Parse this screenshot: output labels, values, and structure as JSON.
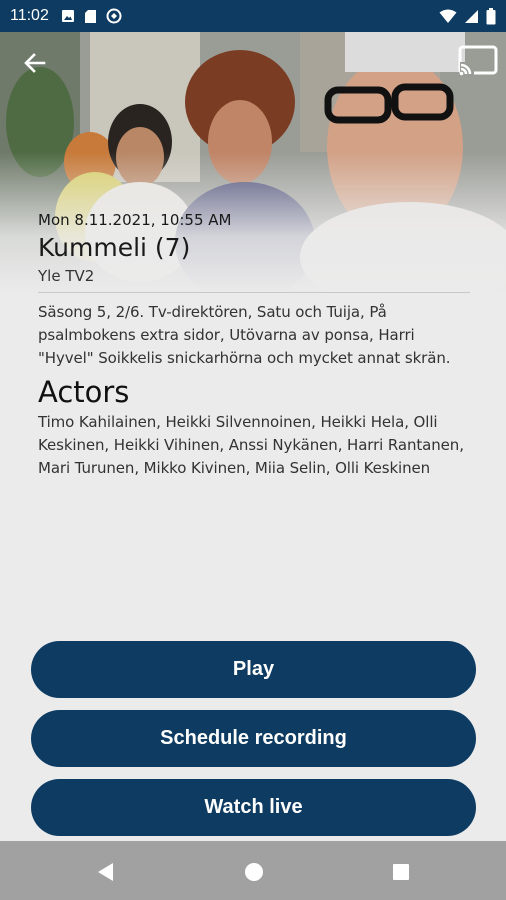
{
  "status_bar": {
    "time": "11:02",
    "left_icons": [
      "image-icon",
      "sd-card-icon",
      "sync-icon"
    ],
    "right_icons": [
      "wifi-icon",
      "signal-icon",
      "battery-icon"
    ]
  },
  "header": {
    "back_icon": "arrow-back-icon",
    "cast_icon": "cast-icon"
  },
  "program": {
    "air_time": "Mon 8.11.2021, 10:55 AM",
    "title": "Kummeli (7)",
    "channel": "Yle TV2",
    "description": "Säsong 5, 2/6. Tv-direktören, Satu och Tuija, På psalmbokens extra sidor, Utövarna av ponsa, Harri \"Hyvel\" Soikkelis snickarhörna och mycket annat skrän.",
    "actors_heading": "Actors",
    "actors": "Timo Kahilainen, Heikki Silvennoinen, Heikki Hela, Olli Keskinen, Heikki Vihinen, Anssi Nykänen, Harri Rantanen, Mari Turunen, Mikko Kivinen, Miia Selin, Olli Keskinen"
  },
  "actions": {
    "play": "Play",
    "schedule": "Schedule recording",
    "watch_live": "Watch live"
  },
  "colors": {
    "primary": "#0e3b62",
    "background": "#ebebeb",
    "nav_bar": "#a1a1a1"
  }
}
